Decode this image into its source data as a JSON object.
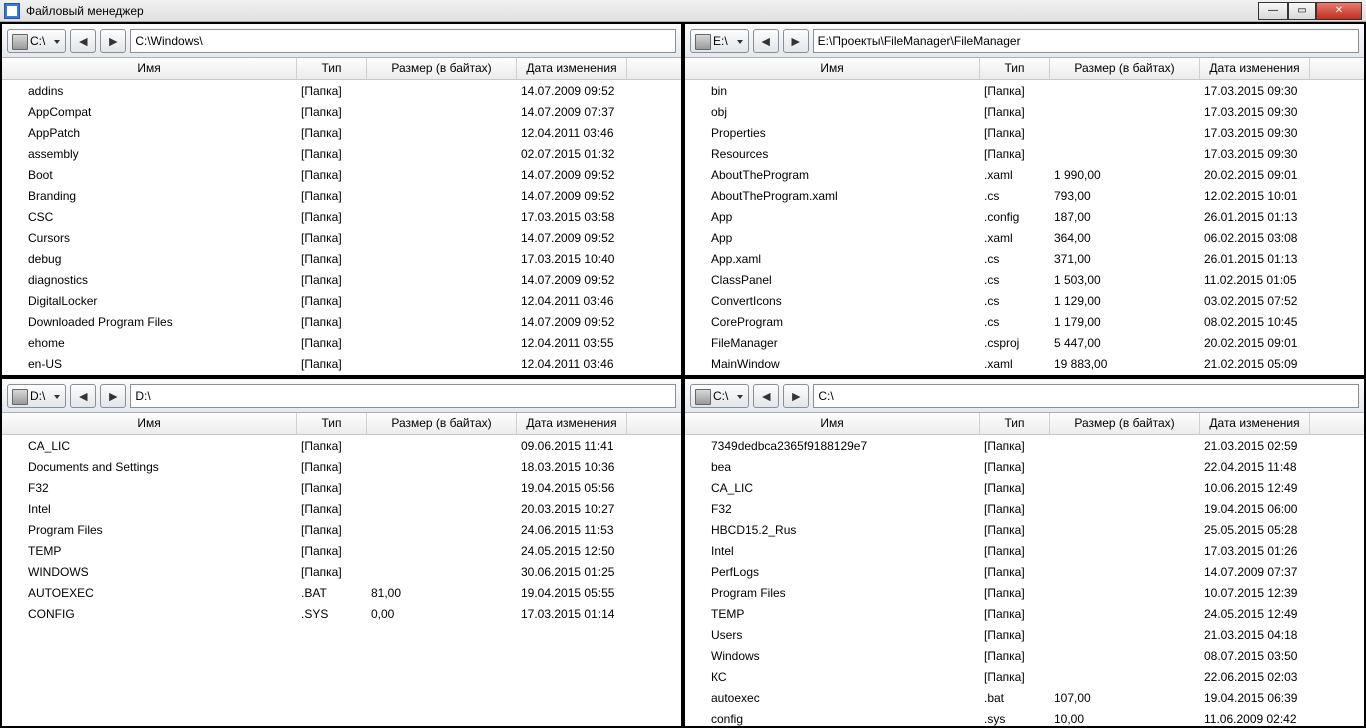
{
  "window": {
    "title": "Файловый менеджер"
  },
  "columns": {
    "name": "Имя",
    "type": "Тип",
    "size": "Размер (в байтах)",
    "date": "Дата изменения"
  },
  "folder_type": "[Папка]",
  "panes": [
    {
      "drive": "C:\\",
      "path": "C:\\Windows\\",
      "files": [
        {
          "name": "addins",
          "type": "[Папка]",
          "size": "",
          "date": "14.07.2009  09:52",
          "icon": "folder"
        },
        {
          "name": "AppCompat",
          "type": "[Папка]",
          "size": "",
          "date": "14.07.2009  07:37",
          "icon": "folder"
        },
        {
          "name": "AppPatch",
          "type": "[Папка]",
          "size": "",
          "date": "12.04.2011  03:46",
          "icon": "folder"
        },
        {
          "name": "assembly",
          "type": "[Папка]",
          "size": "",
          "date": "02.07.2015  01:32",
          "icon": "folder"
        },
        {
          "name": "Boot",
          "type": "[Папка]",
          "size": "",
          "date": "14.07.2009  09:52",
          "icon": "folder"
        },
        {
          "name": "Branding",
          "type": "[Папка]",
          "size": "",
          "date": "14.07.2009  09:52",
          "icon": "folder"
        },
        {
          "name": "CSC",
          "type": "[Папка]",
          "size": "",
          "date": "17.03.2015  03:58",
          "icon": "folder"
        },
        {
          "name": "Cursors",
          "type": "[Папка]",
          "size": "",
          "date": "14.07.2009  09:52",
          "icon": "folder"
        },
        {
          "name": "debug",
          "type": "[Папка]",
          "size": "",
          "date": "17.03.2015  10:40",
          "icon": "folder"
        },
        {
          "name": "diagnostics",
          "type": "[Папка]",
          "size": "",
          "date": "14.07.2009  09:52",
          "icon": "folder"
        },
        {
          "name": "DigitalLocker",
          "type": "[Папка]",
          "size": "",
          "date": "12.04.2011  03:46",
          "icon": "folder"
        },
        {
          "name": "Downloaded Program Files",
          "type": "[Папка]",
          "size": "",
          "date": "14.07.2009  09:52",
          "icon": "folder"
        },
        {
          "name": "ehome",
          "type": "[Папка]",
          "size": "",
          "date": "12.04.2011  03:55",
          "icon": "folder"
        },
        {
          "name": "en-US",
          "type": "[Папка]",
          "size": "",
          "date": "12.04.2011  03:46",
          "icon": "folder"
        }
      ]
    },
    {
      "drive": "E:\\",
      "path": "E:\\Проекты\\FileManager\\FileManager",
      "files": [
        {
          "name": "bin",
          "type": "[Папка]",
          "size": "",
          "date": "17.03.2015  09:30",
          "icon": "folder"
        },
        {
          "name": "obj",
          "type": "[Папка]",
          "size": "",
          "date": "17.03.2015  09:30",
          "icon": "folder"
        },
        {
          "name": "Properties",
          "type": "[Папка]",
          "size": "",
          "date": "17.03.2015  09:30",
          "icon": "folder"
        },
        {
          "name": "Resources",
          "type": "[Папка]",
          "size": "",
          "date": "17.03.2015  09:30",
          "icon": "folder"
        },
        {
          "name": "AboutTheProgram",
          "type": ".xaml",
          "size": "1 990,00",
          "date": "20.02.2015  09:01",
          "icon": "xaml"
        },
        {
          "name": "AboutTheProgram.xaml",
          "type": ".cs",
          "size": "793,00",
          "date": "12.02.2015  10:01",
          "icon": "file"
        },
        {
          "name": "App",
          "type": ".config",
          "size": "187,00",
          "date": "26.01.2015  01:13",
          "icon": "file"
        },
        {
          "name": "App",
          "type": ".xaml",
          "size": "364,00",
          "date": "06.02.2015  03:08",
          "icon": "xaml"
        },
        {
          "name": "App.xaml",
          "type": ".cs",
          "size": "371,00",
          "date": "26.01.2015  01:13",
          "icon": "file"
        },
        {
          "name": "ClassPanel",
          "type": ".cs",
          "size": "1 503,00",
          "date": "11.02.2015  01:05",
          "icon": "file"
        },
        {
          "name": "ConvertIcons",
          "type": ".cs",
          "size": "1 129,00",
          "date": "03.02.2015  07:52",
          "icon": "file"
        },
        {
          "name": "CoreProgram",
          "type": ".cs",
          "size": "1 179,00",
          "date": "08.02.2015  10:45",
          "icon": "file"
        },
        {
          "name": "FileManager",
          "type": ".csproj",
          "size": "5 447,00",
          "date": "20.02.2015  09:01",
          "icon": "proj"
        },
        {
          "name": "MainWindow",
          "type": ".xaml",
          "size": "19 883,00",
          "date": "21.02.2015  05:09",
          "icon": "xaml"
        }
      ]
    },
    {
      "drive": "D:\\",
      "path": "D:\\",
      "files": [
        {
          "name": "CA_LIC",
          "type": "[Папка]",
          "size": "",
          "date": "09.06.2015  11:41",
          "icon": "folder"
        },
        {
          "name": "Documents and Settings",
          "type": "[Папка]",
          "size": "",
          "date": "18.03.2015  10:36",
          "icon": "folder"
        },
        {
          "name": "F32",
          "type": "[Папка]",
          "size": "",
          "date": "19.04.2015  05:56",
          "icon": "folder"
        },
        {
          "name": "Intel",
          "type": "[Папка]",
          "size": "",
          "date": "20.03.2015  10:27",
          "icon": "folder"
        },
        {
          "name": "Program Files",
          "type": "[Папка]",
          "size": "",
          "date": "24.06.2015  11:53",
          "icon": "folder"
        },
        {
          "name": "TEMP",
          "type": "[Папка]",
          "size": "",
          "date": "24.05.2015  12:50",
          "icon": "folder"
        },
        {
          "name": "WINDOWS",
          "type": "[Папка]",
          "size": "",
          "date": "30.06.2015  01:25",
          "icon": "folder"
        },
        {
          "name": "AUTOEXEC",
          "type": ".BAT",
          "size": "81,00",
          "date": "19.04.2015  05:55",
          "icon": "file"
        },
        {
          "name": "CONFIG",
          "type": ".SYS",
          "size": "0,00",
          "date": "17.03.2015  01:14",
          "icon": "file"
        }
      ]
    },
    {
      "drive": "C:\\",
      "path": "C:\\",
      "files": [
        {
          "name": "7349dedbca2365f9188129e7",
          "type": "[Папка]",
          "size": "",
          "date": "21.03.2015  02:59",
          "icon": "folder"
        },
        {
          "name": "bea",
          "type": "[Папка]",
          "size": "",
          "date": "22.04.2015  11:48",
          "icon": "folder"
        },
        {
          "name": "CA_LIC",
          "type": "[Папка]",
          "size": "",
          "date": "10.06.2015  12:49",
          "icon": "folder"
        },
        {
          "name": "F32",
          "type": "[Папка]",
          "size": "",
          "date": "19.04.2015  06:00",
          "icon": "folder"
        },
        {
          "name": "HBCD15.2_Rus",
          "type": "[Папка]",
          "size": "",
          "date": "25.05.2015  05:28",
          "icon": "folder"
        },
        {
          "name": "Intel",
          "type": "[Папка]",
          "size": "",
          "date": "17.03.2015  01:26",
          "icon": "folder"
        },
        {
          "name": "PerfLogs",
          "type": "[Папка]",
          "size": "",
          "date": "14.07.2009  07:37",
          "icon": "folder"
        },
        {
          "name": "Program Files",
          "type": "[Папка]",
          "size": "",
          "date": "10.07.2015  12:39",
          "icon": "folder"
        },
        {
          "name": "TEMP",
          "type": "[Папка]",
          "size": "",
          "date": "24.05.2015  12:49",
          "icon": "folder"
        },
        {
          "name": "Users",
          "type": "[Папка]",
          "size": "",
          "date": "21.03.2015  04:18",
          "icon": "folder"
        },
        {
          "name": "Windows",
          "type": "[Папка]",
          "size": "",
          "date": "08.07.2015  03:50",
          "icon": "folder"
        },
        {
          "name": "КС",
          "type": "[Папка]",
          "size": "",
          "date": "22.06.2015  02:03",
          "icon": "folder"
        },
        {
          "name": "autoexec",
          "type": ".bat",
          "size": "107,00",
          "date": "19.04.2015  06:39",
          "icon": "file"
        },
        {
          "name": "config",
          "type": ".sys",
          "size": "10,00",
          "date": "11.06.2009  02:42",
          "icon": "file"
        }
      ]
    }
  ]
}
